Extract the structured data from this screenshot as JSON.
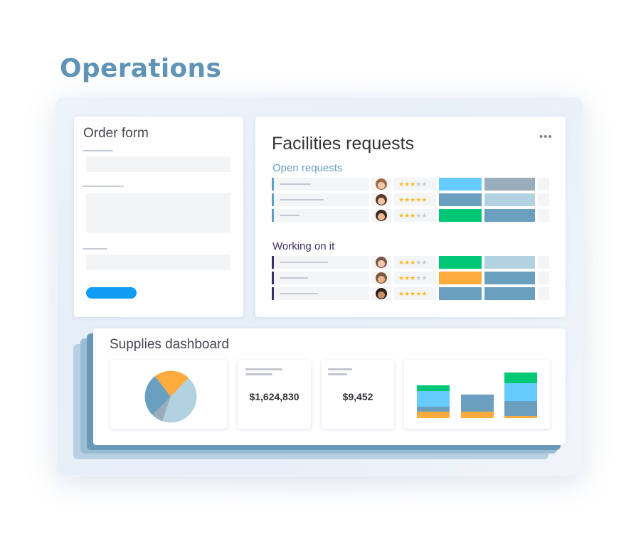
{
  "page": {
    "title": "Operations"
  },
  "order_form": {
    "title": "Order form"
  },
  "facilities": {
    "title": "Facilities requests",
    "menu_icon": "ellipsis-icon",
    "groups": [
      {
        "title": "Open requests",
        "color": "#5f9fc4",
        "rows": [
          {
            "avatar": "person-avatar",
            "rating": 3,
            "status_color": "#66ccff",
            "priority_color": "#9aadbd"
          },
          {
            "avatar": "person-avatar",
            "rating": 5,
            "status_color": "#6a9fc0",
            "priority_color": "#b2d2e2"
          },
          {
            "avatar": "person-avatar",
            "rating": 3,
            "status_color": "#00c875",
            "priority_color": "#6a9fc0"
          }
        ]
      },
      {
        "title": "Working on it",
        "color": "#3f2d6e",
        "rows": [
          {
            "avatar": "person-avatar",
            "rating": 3,
            "status_color": "#00c875",
            "priority_color": "#b2d2e2"
          },
          {
            "avatar": "person-avatar",
            "rating": 3,
            "status_color": "#fdab3d",
            "priority_color": "#6a9fc0"
          },
          {
            "avatar": "person-avatar",
            "rating": 5,
            "status_color": "#6a9fc0",
            "priority_color": "#6a9fc0"
          }
        ]
      }
    ]
  },
  "supplies": {
    "title": "Supplies dashboard",
    "value_1": "$1,624,830",
    "value_2": "$9,452"
  },
  "colors": {
    "accent": "#5f94b6",
    "primary_button": "#0e9cf4",
    "green": "#00c875",
    "orange": "#fdab3d",
    "sky": "#66ccff",
    "steel": "#6a9fc0",
    "pale_steel": "#b2d2e2"
  }
}
